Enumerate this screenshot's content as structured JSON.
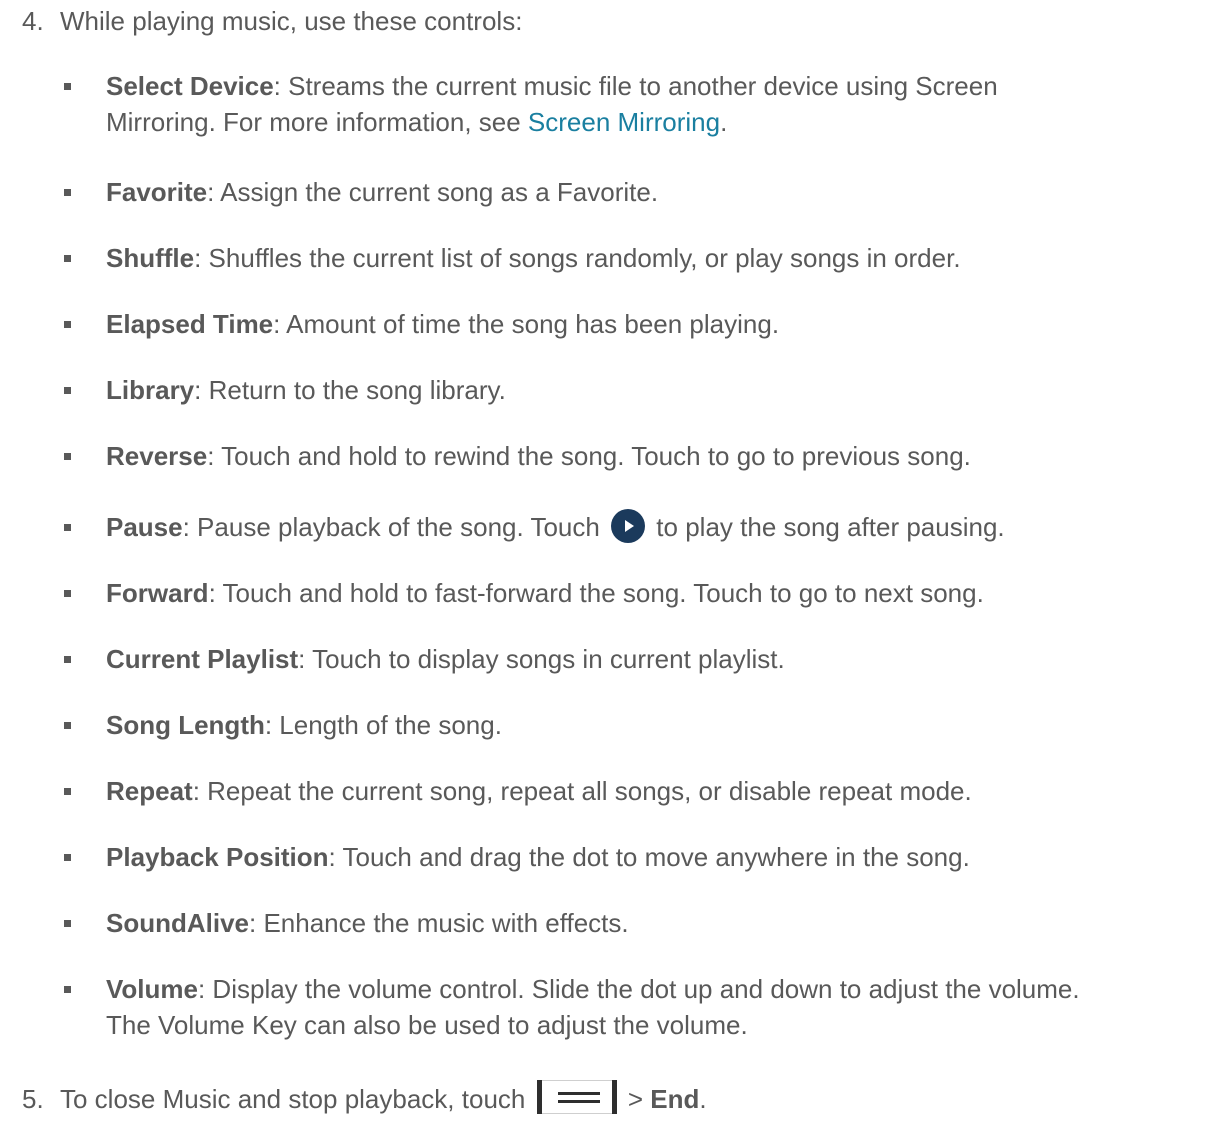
{
  "step4": {
    "number": "4.",
    "text": "While playing music, use these controls:"
  },
  "controls": [
    {
      "term": "Select Device",
      "desc": ": Streams the current music file to another device using Screen",
      "desc2": "Mirroring. For more information, see ",
      "link": "Screen Mirroring",
      "end": "."
    },
    {
      "term": "Favorite",
      "desc": ": Assign the current song as a Favorite."
    },
    {
      "term": "Shuffle",
      "desc": ": Shuffles the current list of songs randomly, or play songs in order."
    },
    {
      "term": "Elapsed Time",
      "desc": ": Amount of time the song has been playing."
    },
    {
      "term": "Library",
      "desc": ": Return to the song library."
    },
    {
      "term": "Reverse",
      "desc": ": Touch and hold to rewind the song. Touch to go to previous song."
    },
    {
      "term": "Pause",
      "desc": ": Pause playback of the song. Touch ",
      "desc_after": " to play the song after pausing."
    },
    {
      "term": "Forward",
      "desc": ": Touch and hold to fast-forward the song. Touch to go to next song."
    },
    {
      "term": "Current Playlist",
      "desc": ": Touch to display songs in current playlist."
    },
    {
      "term": "Song Length",
      "desc": ": Length of the song."
    },
    {
      "term": "Repeat",
      "desc": ": Repeat the current song, repeat all songs, or disable repeat mode."
    },
    {
      "term": "Playback Position",
      "desc": ": Touch and drag the dot to move anywhere in the song."
    },
    {
      "term": "SoundAlive",
      "desc": ": Enhance the music with effects."
    },
    {
      "term": "Volume",
      "desc": ": Display the volume control. Slide the dot up and down to adjust the volume.",
      "desc2": "The Volume Key can also be used to adjust the volume."
    }
  ],
  "step5": {
    "number": "5.",
    "text_before": "To close Music and stop playback, touch ",
    "separator": " > ",
    "end_label": "End",
    "end_punct": "."
  },
  "icons": {
    "play": "play-circle-icon",
    "menu": "menu-icon"
  },
  "colors": {
    "text": "#595959",
    "link": "#1a7fa0",
    "play_icon": "#1b3a5c"
  }
}
